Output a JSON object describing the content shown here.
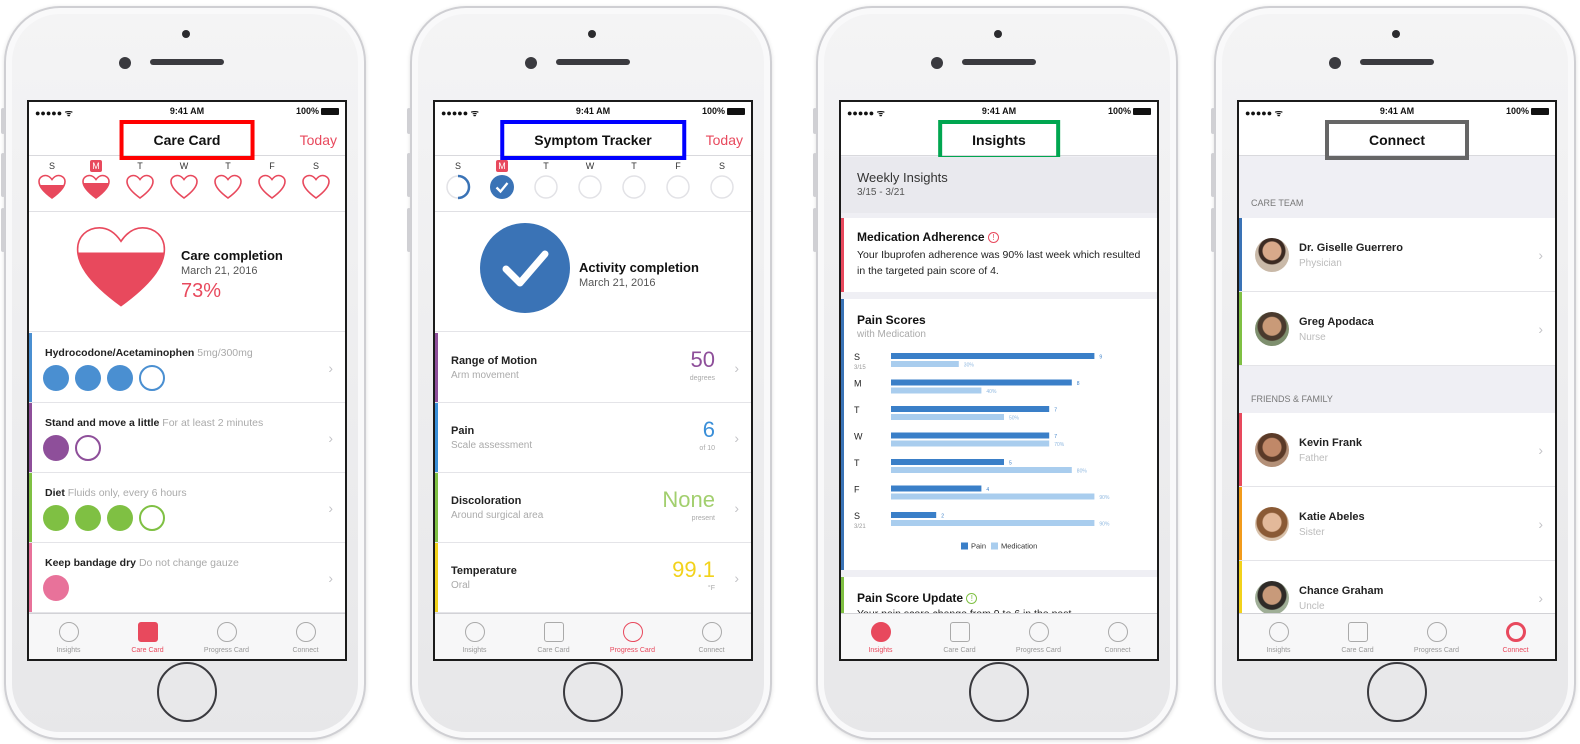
{
  "status": {
    "signal": "●●●●● ᯤ",
    "time": "9:41 AM",
    "battery": "100%"
  },
  "weekdays": [
    "S",
    "M",
    "T",
    "W",
    "T",
    "F",
    "S"
  ],
  "tabs": [
    "Insights",
    "Care Card",
    "Progress Card",
    "Connect"
  ],
  "colors": {
    "accent": "#e8495d",
    "blue": "#3a73b6",
    "purple": "#8e4f9a",
    "green": "#8bc34a",
    "pink": "#e8729a",
    "yellow": "#f2d21b",
    "red_box": "#ff0000",
    "blue_box": "#0000ff",
    "green_box": "#00a650",
    "gray_box": "#666666"
  },
  "care": {
    "title": "Care Card",
    "today": "Today",
    "completion_title": "Care completion",
    "completion_date": "March 21, 2016",
    "completion_pct": "73%",
    "completion_value": 0.73,
    "items": [
      {
        "title": "Hydrocodone/Acetaminophen",
        "detail": "5mg/300mg",
        "color": "#4a8fd1",
        "done": 3,
        "total": 4
      },
      {
        "title": "Stand and move a little",
        "detail": "For at least 2 minutes",
        "color": "#8e4f9a",
        "done": 1,
        "total": 2
      },
      {
        "title": "Diet",
        "detail": "Fluids only, every 6 hours",
        "color": "#7fc043",
        "done": 3,
        "total": 4
      },
      {
        "title": "Keep bandage dry",
        "detail": "Do not change gauze",
        "color": "#e8729a",
        "done": 1,
        "total": 1
      }
    ]
  },
  "symptom": {
    "title": "Symptom Tracker",
    "today": "Today",
    "completion_title": "Activity completion",
    "completion_date": "March 21, 2016",
    "items": [
      {
        "title": "Range of Motion",
        "detail": "Arm movement",
        "value": "50",
        "unit": "degrees",
        "color": "#8e4f9a"
      },
      {
        "title": "Pain",
        "detail": "Scale assessment",
        "value": "6",
        "unit": "of 10",
        "color": "#3a8fd8"
      },
      {
        "title": "Discoloration",
        "detail": "Around surgical area",
        "value": "None",
        "unit": "present",
        "color": "#7fc043"
      },
      {
        "title": "Temperature",
        "detail": "Oral",
        "value": "99.1",
        "unit": "°F",
        "color": "#f2d21b"
      }
    ]
  },
  "insights": {
    "title": "Insights",
    "weekly_title": "Weekly Insights",
    "weekly_range": "3/15 - 3/21",
    "adherence_title": "Medication Adherence",
    "adherence_body": "Your Ibuprofen adherence was 90% last week which resulted in the targeted pain score of 4.",
    "scores_title": "Pain Scores",
    "scores_sub": "with Medication",
    "update_title": "Pain Score Update",
    "update_body": "Your pain score change from 9 to 6 in the past",
    "legend_pain": "Pain",
    "legend_med": "Medication"
  },
  "chart_data": {
    "type": "bar",
    "categories": [
      "S",
      "M",
      "T",
      "W",
      "T",
      "F",
      "S"
    ],
    "category_dates": [
      "3/15",
      "",
      "",
      "",
      "",
      "",
      "3/21"
    ],
    "series": [
      {
        "name": "Pain",
        "values": [
          9,
          8,
          7,
          7,
          5,
          4,
          2
        ],
        "labels": [
          "9",
          "8",
          "7",
          "7",
          "5",
          "4",
          "2"
        ]
      },
      {
        "name": "Medication",
        "values": [
          30,
          40,
          50,
          70,
          80,
          90,
          90
        ],
        "labels": [
          "30%",
          "40%",
          "50%",
          "70%",
          "80%",
          "90%",
          "90%"
        ]
      }
    ],
    "orientation": "horizontal",
    "legend": "bottom"
  },
  "connect": {
    "title": "Connect",
    "care_team_header": "CARE TEAM",
    "friends_header": "FRIENDS & FAMILY",
    "care_team": [
      {
        "name": "Dr. Giselle Guerrero",
        "role": "Physician",
        "color": "#3a73b6"
      },
      {
        "name": "Greg Apodaca",
        "role": "Nurse",
        "color": "#7fc043"
      }
    ],
    "friends": [
      {
        "name": "Kevin Frank",
        "role": "Father",
        "color": "#e8495d"
      },
      {
        "name": "Katie Abeles",
        "role": "Sister",
        "color": "#f29b1b"
      },
      {
        "name": "Chance Graham",
        "role": "Uncle",
        "color": "#f2d21b"
      }
    ]
  }
}
